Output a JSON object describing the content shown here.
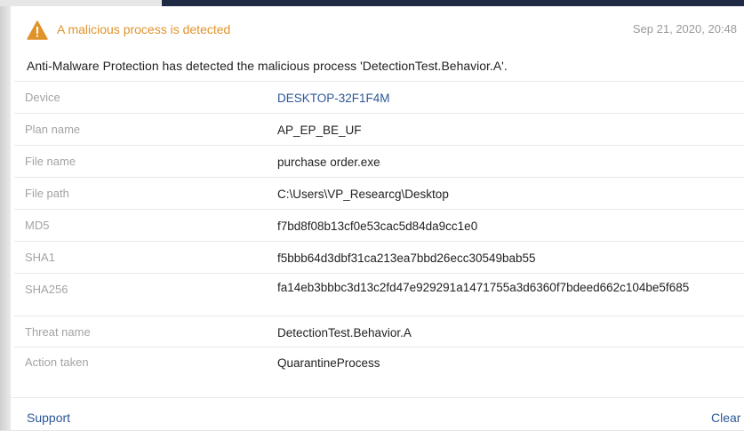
{
  "alert": {
    "title": "A malicious process is detected",
    "timestamp": "Sep 21, 2020, 20:48",
    "description": "Anti-Malware Protection has detected the malicious process 'DetectionTest.Behavior.A'.",
    "icon": "warning-triangle-icon",
    "accent_color": "#e0932b"
  },
  "details": [
    {
      "label": "Device",
      "value": "DESKTOP-32F1F4M",
      "is_link": true
    },
    {
      "label": "Plan name",
      "value": "AP_EP_BE_UF",
      "is_link": false
    },
    {
      "label": "File name",
      "value": "purchase order.exe",
      "is_link": false
    },
    {
      "label": "File path",
      "value": "C:\\Users\\VP_Researcg\\Desktop",
      "is_link": false
    },
    {
      "label": "MD5",
      "value": "f7bd8f08b13cf0e53cac5d84da9cc1e0",
      "is_link": false
    },
    {
      "label": "SHA1",
      "value": "f5bbb64d3dbf31ca213ea7bbd26ecc30549bab55",
      "is_link": false
    },
    {
      "label": "SHA256",
      "value": "fa14eb3bbbc3d13c2fd47e929291a1471755a3d6360f7bdeed662c104be5f685",
      "is_link": false
    },
    {
      "label": "Threat name",
      "value": "DetectionTest.Behavior.A",
      "is_link": false
    },
    {
      "label": "Action taken",
      "value": "QuarantineProcess",
      "is_link": false
    }
  ],
  "footer": {
    "support_label": "Support",
    "clear_label": "Clear"
  },
  "colors": {
    "link": "#2b5797",
    "label": "#a3a3a3",
    "header_bar": "#1f2a44"
  }
}
